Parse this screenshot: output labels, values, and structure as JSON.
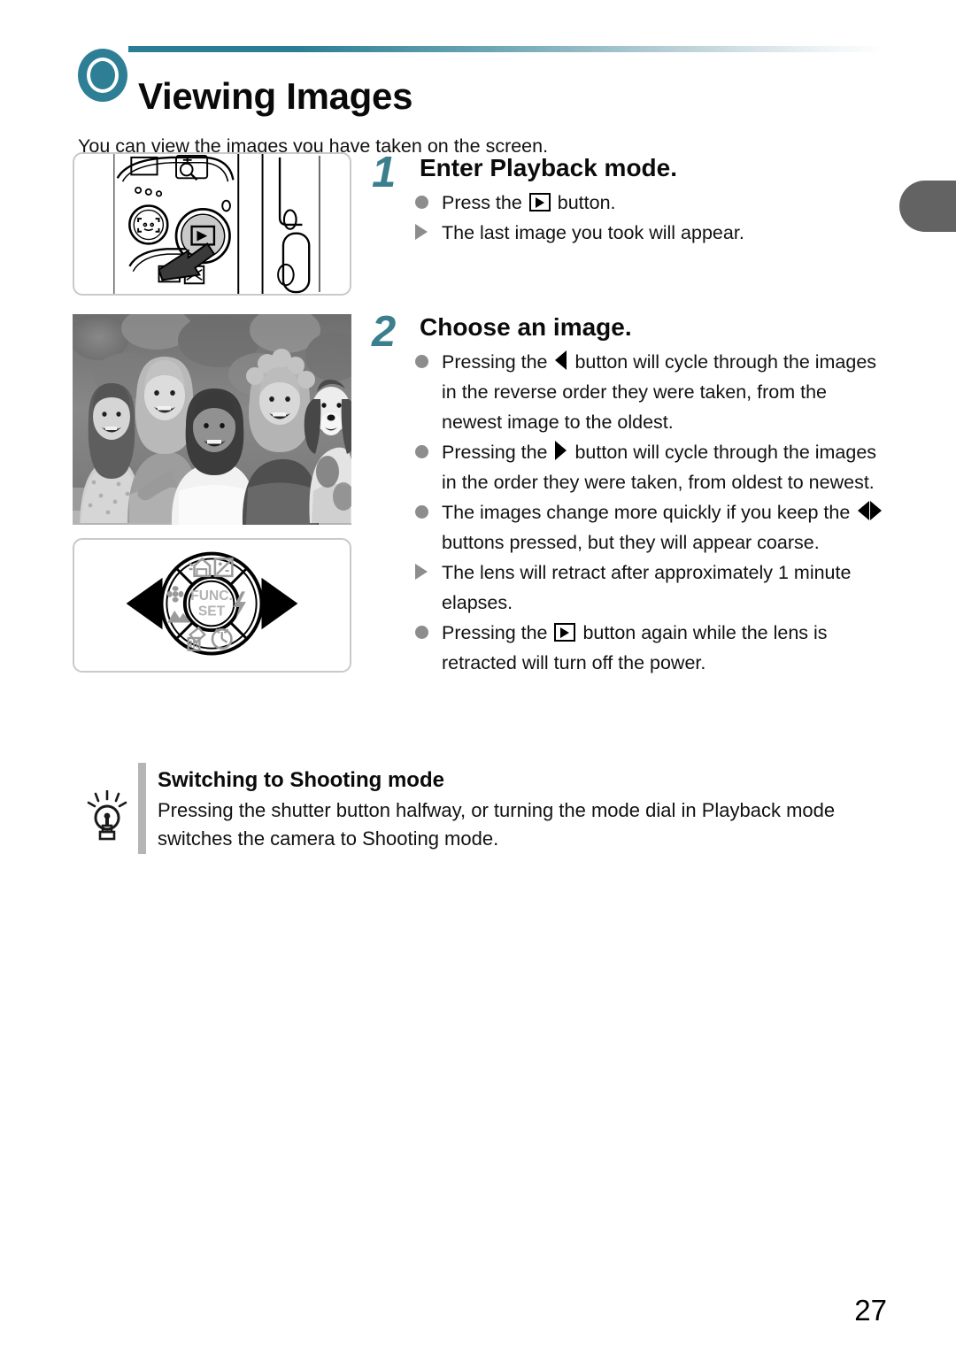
{
  "page": {
    "title": "Viewing Images",
    "intro": "You can view the images you have taken on the screen.",
    "number": "27",
    "accent_color": "#2e7f96",
    "step_number_color": "#3b7e8d",
    "bullet_color": "#8d8d8d",
    "edge_tab_color": "#636363"
  },
  "steps": [
    {
      "number": "1",
      "title": "Enter Playback mode.",
      "bullets": [
        {
          "marker": "dot",
          "parts": [
            {
              "t": "text",
              "v": "Press the "
            },
            {
              "t": "icon",
              "v": "playback-button-icon"
            },
            {
              "t": "text",
              "v": " button."
            }
          ]
        },
        {
          "marker": "triangle",
          "parts": [
            {
              "t": "text",
              "v": "The last image you took will appear."
            }
          ]
        }
      ]
    },
    {
      "number": "2",
      "title": "Choose an image.",
      "bullets": [
        {
          "marker": "dot",
          "parts": [
            {
              "t": "text",
              "v": "Pressing the "
            },
            {
              "t": "icon",
              "v": "left-arrow-icon"
            },
            {
              "t": "text",
              "v": " button will cycle through the images in the reverse order they were taken, from the newest image to the oldest."
            }
          ]
        },
        {
          "marker": "dot",
          "parts": [
            {
              "t": "text",
              "v": "Pressing the "
            },
            {
              "t": "icon",
              "v": "right-arrow-icon"
            },
            {
              "t": "text",
              "v": " button will cycle through the images in the order they were taken, from oldest to newest."
            }
          ]
        },
        {
          "marker": "dot",
          "parts": [
            {
              "t": "text",
              "v": "The images change more quickly if you keep the "
            },
            {
              "t": "icon",
              "v": "left-right-arrows-icon"
            },
            {
              "t": "text",
              "v": " buttons pressed, but they will appear coarse."
            }
          ]
        },
        {
          "marker": "triangle",
          "parts": [
            {
              "t": "text",
              "v": "The lens will retract after approximately 1 minute elapses."
            }
          ]
        },
        {
          "marker": "dot",
          "parts": [
            {
              "t": "text",
              "v": "Pressing the "
            },
            {
              "t": "icon",
              "v": "playback-button-icon"
            },
            {
              "t": "text",
              "v": " button again while the lens is retracted will turn off the power."
            }
          ]
        }
      ]
    }
  ],
  "tip": {
    "icon": "lightbulb-icon",
    "heading": "Switching to Shooting mode",
    "body": "Pressing the shutter button halfway, or turning the mode dial in Playback mode switches the camera to Shooting mode."
  },
  "illustrations": {
    "camera_back": {
      "caption": "camera-back-playback-button-diagram",
      "pressed_control": "playback-button"
    },
    "sample_photo": {
      "caption": "sample-photo-four-children-with-dog"
    },
    "control_dial": {
      "caption": "four-way-control-dial-diagram",
      "center_label_line1": "FUNC.",
      "center_label_line2": "SET",
      "highlighted_directions": [
        "left",
        "right"
      ]
    }
  }
}
